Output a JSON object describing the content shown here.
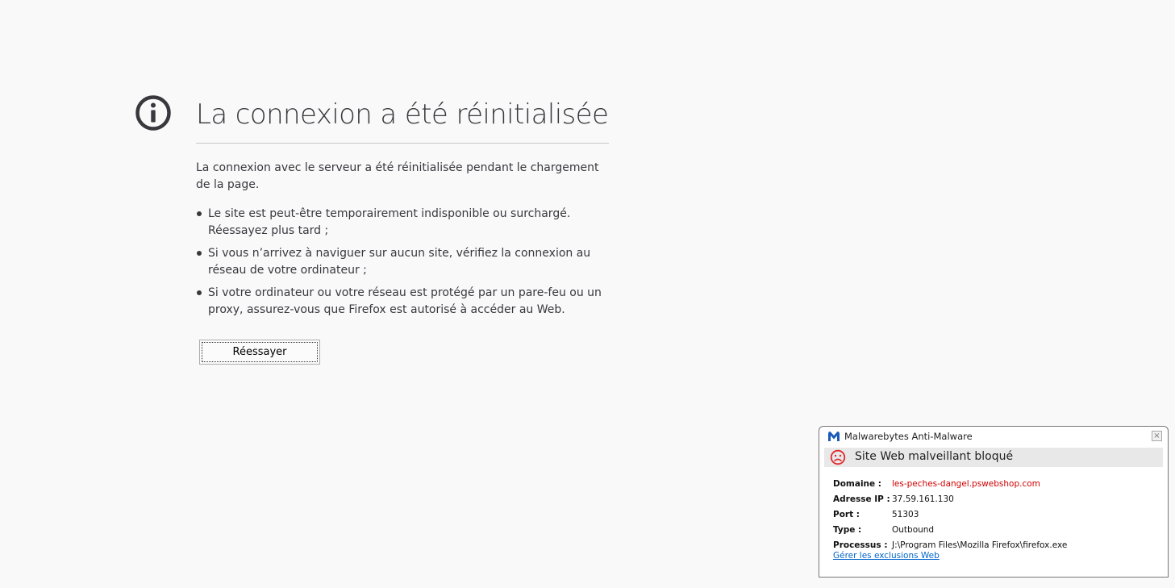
{
  "error_page": {
    "title": "La connexion a été réinitialisée",
    "description": "La connexion avec le serveur a été réinitialisée pendant le chargement de la page.",
    "suggestions": [
      "Le site est peut-être temporairement indisponible ou surchargé. Réessayez plus tard ;",
      "Si vous n’arrivez à naviguer sur aucun site, vérifiez la connexion au réseau de votre ordinateur ;",
      "Si votre ordinateur ou votre réseau est protégé par un pare-feu ou un proxy, assurez-vous que Firefox est autorisé à accéder au Web."
    ],
    "retry_label": "Réessayer",
    "icon": "info-icon"
  },
  "malwarebytes": {
    "app_title": "Malwarebytes Anti-Malware",
    "banner": "Site Web malveillant bloqué",
    "close_glyph": "×",
    "details": [
      {
        "label": "Domaine :",
        "value": "les-peches-dangel.pswebshop.com"
      },
      {
        "label": "Adresse IP :",
        "value": "37.59.161.130"
      },
      {
        "label": "Port :",
        "value": "51303"
      },
      {
        "label": "Type :",
        "value": "Outbound"
      },
      {
        "label": "Processus :",
        "value": "J:\\Program Files\\Mozilla Firefox\\firefox.exe"
      }
    ],
    "manage_link": "Gérer les exclusions Web",
    "colors": {
      "danger": "#d10000",
      "link": "#0066cc",
      "sad_icon": "#e0282e",
      "logo": "#1a5ab8"
    }
  }
}
